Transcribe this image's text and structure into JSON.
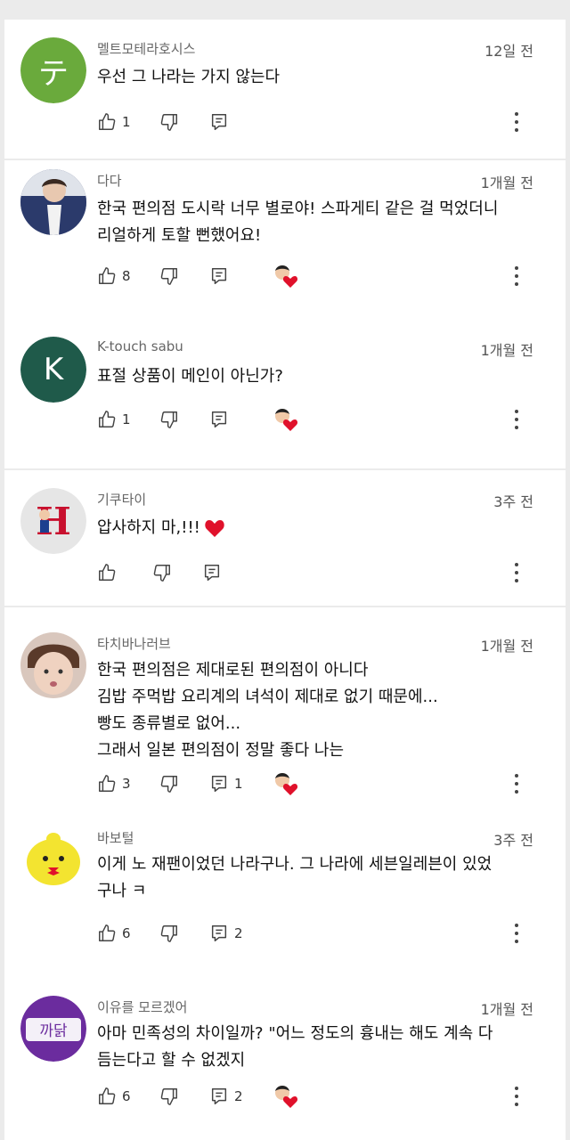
{
  "comments": [
    {
      "author": "멜트모테라호시스",
      "time": "12일 전",
      "avatar_letter": "テ",
      "avatar_color": "#6aaa3c",
      "lines": [
        "우선 그 나라는 가지 않는다"
      ],
      "likes": "1",
      "replies": "",
      "creator_heart": false
    },
    {
      "author": "다다",
      "time": "1개월 전",
      "avatar_color": "#2b3a6b",
      "lines": [
        "한국 편의점 도시락 너무 별로야! 스파게티 같은 걸 먹었더니",
        "리얼하게 토할 뻔했어요!"
      ],
      "likes": "8",
      "replies": "",
      "creator_heart": true
    },
    {
      "author": "K-touch sabu",
      "time": "1개월 전",
      "avatar_letter": "K",
      "avatar_color": "#1f5a4a",
      "lines": [
        "표절 상품이 메인이 아닌가?"
      ],
      "likes": "1",
      "replies": "",
      "creator_heart": true
    },
    {
      "author": "기쿠타이",
      "time": "3주 전",
      "avatar_letter": "H",
      "avatar_color": "#e6e6e6",
      "lines": [
        "압사하지 마,!!!"
      ],
      "likes": "",
      "replies": "",
      "creator_heart": false
    },
    {
      "author": "타치바나러브",
      "time": "1개월 전",
      "avatar_color": "#d9c7bd",
      "lines": [
        "한국 편의점은 제대로된 편의점이 아니다",
        "김밥 주먹밥 요리계의 녀석이 제대로 없기 때문에...",
        "빵도 종류별로 없어...",
        "그래서 일본 편의점이 정말 좋다 나는"
      ],
      "likes": "3",
      "replies": "1",
      "creator_heart": true
    },
    {
      "author": "바보털",
      "time": "3주 전",
      "avatar_color": "#f3e430",
      "lines": [
        "이게 노 재팬이었던 나라구나. 그 나라에 세븐일레븐이 있었",
        "구나 ㅋ"
      ],
      "likes": "6",
      "replies": "2",
      "creator_heart": false
    },
    {
      "author": "이유를 모르겠어",
      "time": "1개월 전",
      "avatar_text": "까닭",
      "avatar_color": "#6b2c9e",
      "lines": [
        "아마 민족성의 차이일까? \"어느 정도의 흉내는 해도 계속 다",
        "듬는다고 할 수 없겠지"
      ],
      "likes": "6",
      "replies": "2",
      "creator_heart": true
    }
  ]
}
